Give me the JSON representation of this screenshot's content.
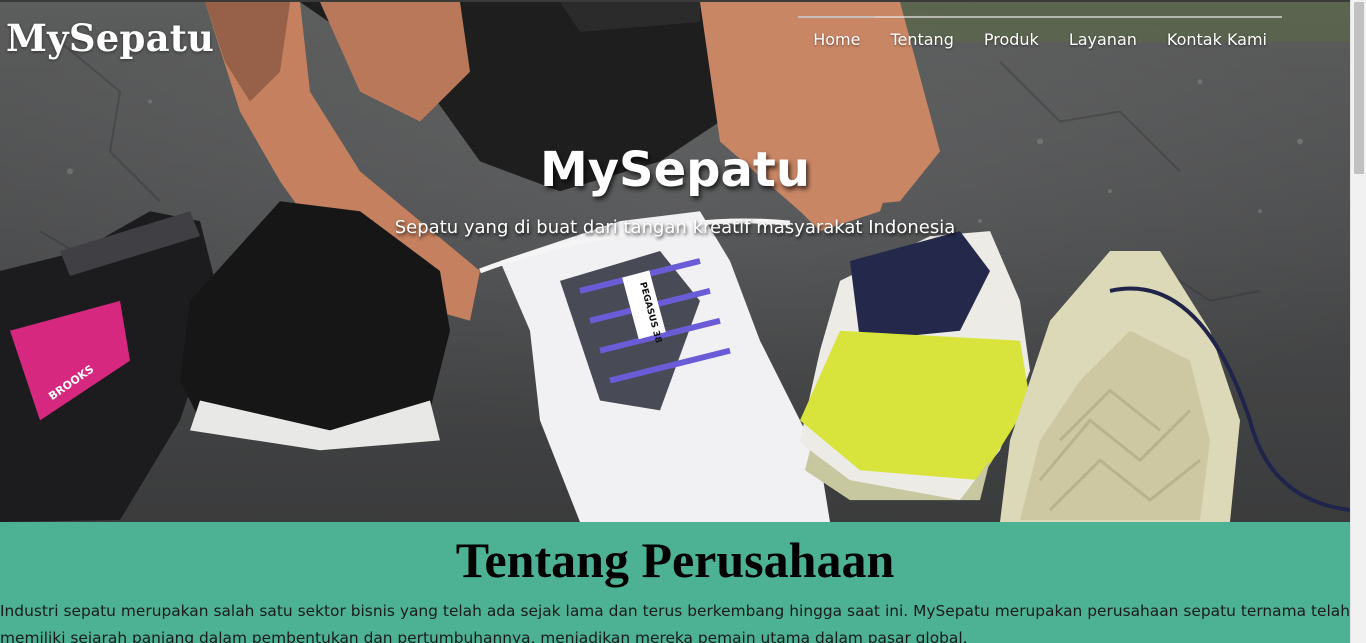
{
  "header": {
    "brand": "MySepatu",
    "nav": [
      {
        "label": "Home"
      },
      {
        "label": "Tentang"
      },
      {
        "label": "Produk"
      },
      {
        "label": "Layanan"
      },
      {
        "label": "Kontak Kami"
      }
    ]
  },
  "hero": {
    "title": "MySepatu",
    "subtitle": "Sepatu yang di buat dari tangan kreatif masyarakat Indonesia",
    "shoe_text": [
      "BROOKS",
      "PEGASUS 38"
    ]
  },
  "about": {
    "title": "Tentang Perusahaan",
    "text": "Industri sepatu merupakan salah satu sektor bisnis yang telah ada sejak lama dan terus berkembang hingga saat ini. MySepatu merupakan perusahaan sepatu ternama telah memiliki sejarah panjang dalam pembentukan dan pertumbuhannya, menjadikan mereka pemain utama dalam pasar global."
  },
  "colors": {
    "about_bg": "#4db294",
    "text_white": "#ffffff"
  }
}
